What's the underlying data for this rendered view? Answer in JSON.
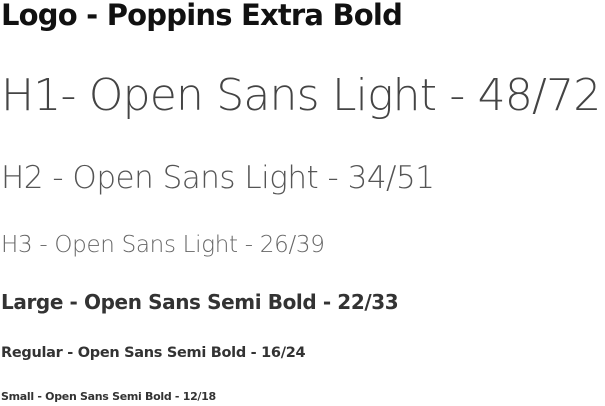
{
  "typography": {
    "logo": "Logo - Poppins Extra Bold",
    "h1": "H1- Open Sans Light - 48/72",
    "h2": "H2 - Open Sans Light - 34/51",
    "h3": "H3 - Open Sans Light - 26/39",
    "large": "Large - Open Sans Semi Bold - 22/33",
    "regular": "Regular - Open Sans Semi Bold - 16/24",
    "small": "Small - Open Sans Semi Bold - 12/18"
  }
}
